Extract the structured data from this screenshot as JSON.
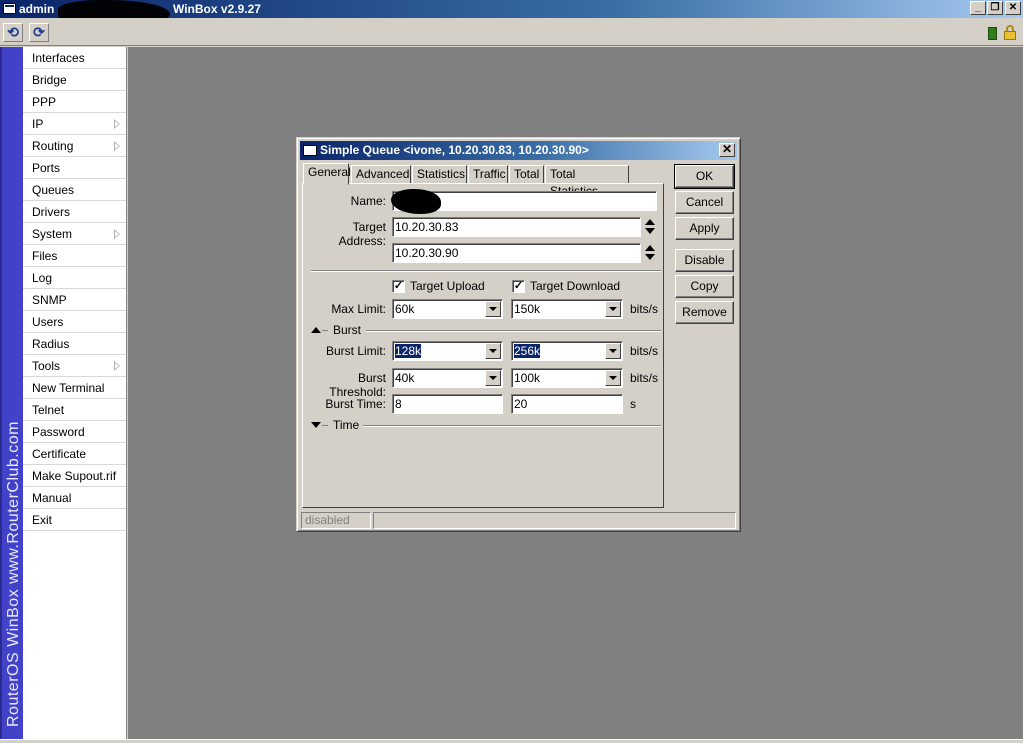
{
  "app": {
    "user_label": "admin",
    "version": "WinBox v2.9.27",
    "brand_vertical": "RouterOS WinBox   www.RouterClub.com"
  },
  "window_controls": {
    "minimize": "_",
    "restore": "❐",
    "close": "✕"
  },
  "toolbar": {
    "undo_icon": "⟲",
    "redo_icon": "⟳"
  },
  "menu": {
    "items": [
      {
        "label": "Interfaces",
        "submenu": false
      },
      {
        "label": "Bridge",
        "submenu": false
      },
      {
        "label": "PPP",
        "submenu": false
      },
      {
        "label": "IP",
        "submenu": true
      },
      {
        "label": "Routing",
        "submenu": true
      },
      {
        "label": "Ports",
        "submenu": false
      },
      {
        "label": "Queues",
        "submenu": false
      },
      {
        "label": "Drivers",
        "submenu": false
      },
      {
        "label": "System",
        "submenu": true
      },
      {
        "label": "Files",
        "submenu": false
      },
      {
        "label": "Log",
        "submenu": false
      },
      {
        "label": "SNMP",
        "submenu": false
      },
      {
        "label": "Users",
        "submenu": false
      },
      {
        "label": "Radius",
        "submenu": false
      },
      {
        "label": "Tools",
        "submenu": true
      },
      {
        "label": "New Terminal",
        "submenu": false
      },
      {
        "label": "Telnet",
        "submenu": false
      },
      {
        "label": "Password",
        "submenu": false
      },
      {
        "label": "Certificate",
        "submenu": false
      },
      {
        "label": "Make Supout.rif",
        "submenu": false
      },
      {
        "label": "Manual",
        "submenu": false
      },
      {
        "label": "Exit",
        "submenu": false
      }
    ]
  },
  "dialog": {
    "title": "Simple Queue <ivone, 10.20.30.83, 10.20.30.90>",
    "close": "✕",
    "tabs": [
      "General",
      "Advanced",
      "Statistics",
      "Traffic",
      "Total",
      "Total Statistics"
    ],
    "active_tab": "General",
    "labels": {
      "name": "Name:",
      "target_address": "Target Address:",
      "target_upload": "Target Upload",
      "target_download": "Target Download",
      "max_limit": "Max Limit:",
      "burst_section": "Burst",
      "burst_limit": "Burst Limit:",
      "burst_threshold": "Burst Threshold:",
      "burst_time": "Burst Time:",
      "time_section": "Time",
      "bits_unit": "bits/s",
      "seconds_unit": "s"
    },
    "values": {
      "name": "",
      "target_address_1": "10.20.30.83",
      "target_address_2": "10.20.30.90",
      "target_upload_checked": "✓",
      "target_download_checked": "✓",
      "max_limit_upload": "60k",
      "max_limit_download": "150k",
      "burst_limit_upload": "128k",
      "burst_limit_download": "256k",
      "burst_threshold_upload": "40k",
      "burst_threshold_download": "100k",
      "burst_time_upload": "8",
      "burst_time_download": "20"
    },
    "buttons": {
      "ok": "OK",
      "cancel": "Cancel",
      "apply": "Apply",
      "disable": "Disable",
      "copy": "Copy",
      "remove": "Remove"
    },
    "status": {
      "state": "disabled",
      "extra": ""
    }
  }
}
